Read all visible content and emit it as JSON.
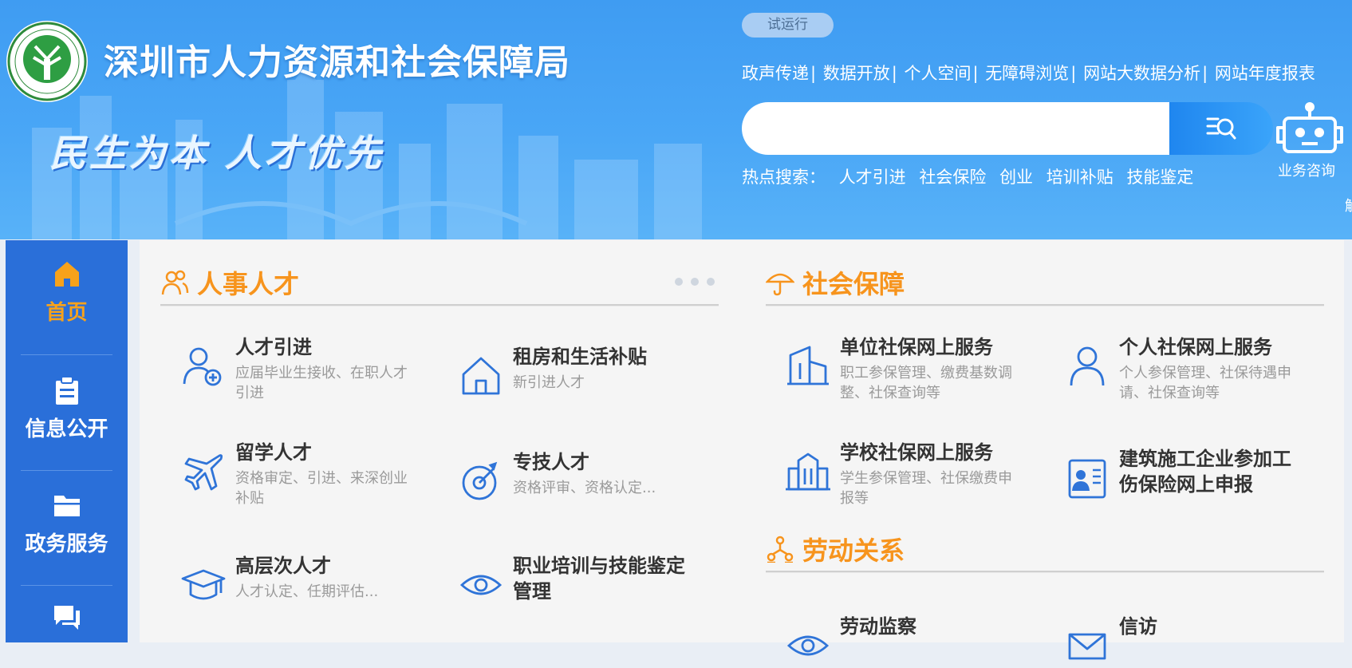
{
  "header": {
    "site_title": "深圳市人力资源和社会保障局",
    "slogan": "民生为本 人才优先",
    "trial_badge": "试运行",
    "top_links": [
      "政声传递",
      "数据开放",
      "个人空间",
      "无障碍浏览",
      "网站大数据分析",
      "网站年度报表"
    ],
    "search": {
      "value": "",
      "placeholder": ""
    },
    "hot_search": {
      "label": "热点搜索：",
      "keywords": [
        "人才引进",
        "社会保险",
        "创业",
        "培训补贴",
        "技能鉴定"
      ]
    },
    "consult_label": "业务咨询",
    "edge_char": "解"
  },
  "sidebar": {
    "items": [
      {
        "label": "首页",
        "icon": "home-icon",
        "active": true
      },
      {
        "label": "信息公开",
        "icon": "clipboard-icon",
        "active": false
      },
      {
        "label": "政务服务",
        "icon": "folder-icon",
        "active": false
      },
      {
        "label": "",
        "icon": "chat-icon",
        "active": false
      }
    ]
  },
  "sections": {
    "personnel": {
      "title": "人事人才",
      "icon": "people-icon",
      "items": [
        {
          "title": "人才引进",
          "desc": "应届毕业生接收、在职人才引进",
          "icon": "user-add-icon"
        },
        {
          "title": "租房和生活补贴",
          "desc": "新引进人才",
          "icon": "house-icon"
        },
        {
          "title": "留学人才",
          "desc": "资格审定、引进、来深创业补贴",
          "icon": "airplane-icon"
        },
        {
          "title": "专技人才",
          "desc": "资格评审、资格认定...",
          "icon": "target-icon"
        },
        {
          "title": "高层次人才",
          "desc": "人才认定、任期评估...",
          "icon": "graduation-cap-icon"
        },
        {
          "title": "职业培训与技能鉴定管理",
          "desc": "",
          "icon": "eye-icon"
        }
      ]
    },
    "social": {
      "title": "社会保障",
      "icon": "umbrella-icon",
      "items": [
        {
          "title": "单位社保网上服务",
          "desc": "职工参保管理、缴费基数调整、社保查询等",
          "icon": "building-icon"
        },
        {
          "title": "个人社保网上服务",
          "desc": "个人参保管理、社保待遇申请、社保查询等",
          "icon": "person-icon"
        },
        {
          "title": "学校社保网上服务",
          "desc": "学生参保管理、社保缴费申报等",
          "icon": "school-icon"
        },
        {
          "title": "建筑施工企业参加工伤保险网上申报",
          "desc": "",
          "icon": "worker-card-icon"
        }
      ]
    },
    "labor": {
      "title": "劳动关系",
      "icon": "org-icon",
      "items": [
        {
          "title": "劳动监察",
          "desc": "",
          "icon": "eye-icon"
        },
        {
          "title": "信访",
          "desc": "",
          "icon": "mail-icon"
        }
      ]
    }
  },
  "colors": {
    "header_blue": "#3f9cf2",
    "sidebar_blue": "#2a6fd9",
    "accent_orange": "#f7941d",
    "icon_blue": "#2f74d8"
  }
}
